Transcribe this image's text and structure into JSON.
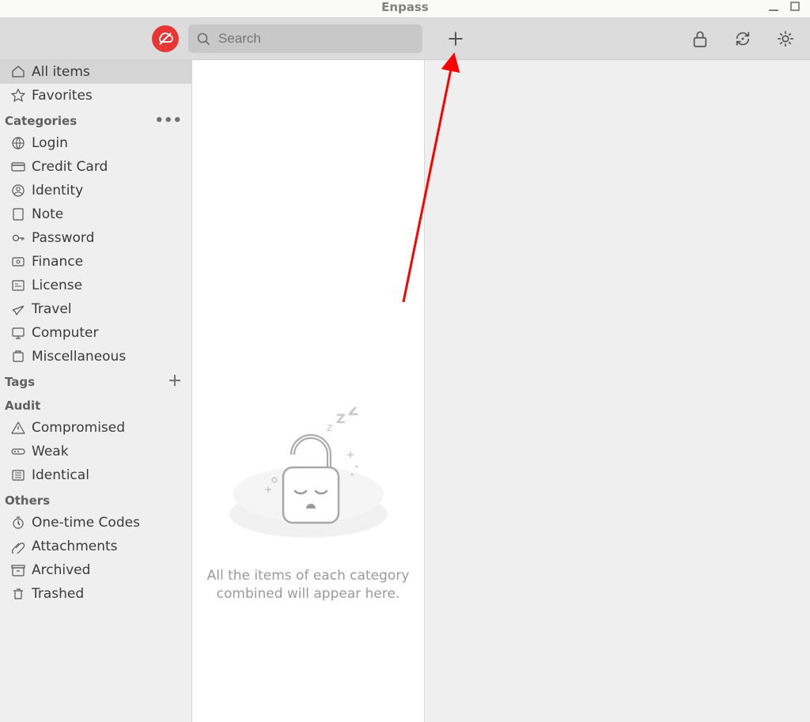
{
  "window": {
    "title": "Enpass"
  },
  "toolbar": {
    "search_placeholder": "Search"
  },
  "sidebar": {
    "topItems": [
      {
        "label": "All items",
        "icon": "home-icon",
        "selected": true
      },
      {
        "label": "Favorites",
        "icon": "star-icon",
        "selected": false
      }
    ],
    "sections": [
      {
        "title": "Categories",
        "action": "dots",
        "items": [
          {
            "label": "Login",
            "icon": "globe-icon"
          },
          {
            "label": "Credit Card",
            "icon": "credit-card-icon"
          },
          {
            "label": "Identity",
            "icon": "identity-icon"
          },
          {
            "label": "Note",
            "icon": "note-icon"
          },
          {
            "label": "Password",
            "icon": "key-icon"
          },
          {
            "label": "Finance",
            "icon": "finance-icon"
          },
          {
            "label": "License",
            "icon": "license-icon"
          },
          {
            "label": "Travel",
            "icon": "travel-icon"
          },
          {
            "label": "Computer",
            "icon": "computer-icon"
          },
          {
            "label": "Miscellaneous",
            "icon": "miscellaneous-icon"
          }
        ]
      },
      {
        "title": "Tags",
        "action": "plus",
        "items": []
      },
      {
        "title": "Audit",
        "action": "none",
        "items": [
          {
            "label": "Compromised",
            "icon": "warning-icon"
          },
          {
            "label": "Weak",
            "icon": "weak-icon"
          },
          {
            "label": "Identical",
            "icon": "identical-icon"
          }
        ]
      },
      {
        "title": "Others",
        "action": "none",
        "items": [
          {
            "label": "One-time Codes",
            "icon": "timer-icon"
          },
          {
            "label": "Attachments",
            "icon": "paperclip-icon"
          },
          {
            "label": "Archived",
            "icon": "archive-icon"
          },
          {
            "label": "Trashed",
            "icon": "trash-icon"
          }
        ]
      }
    ]
  },
  "empty_state": {
    "line1": "All the items of each category",
    "line2": "combined will appear here."
  }
}
